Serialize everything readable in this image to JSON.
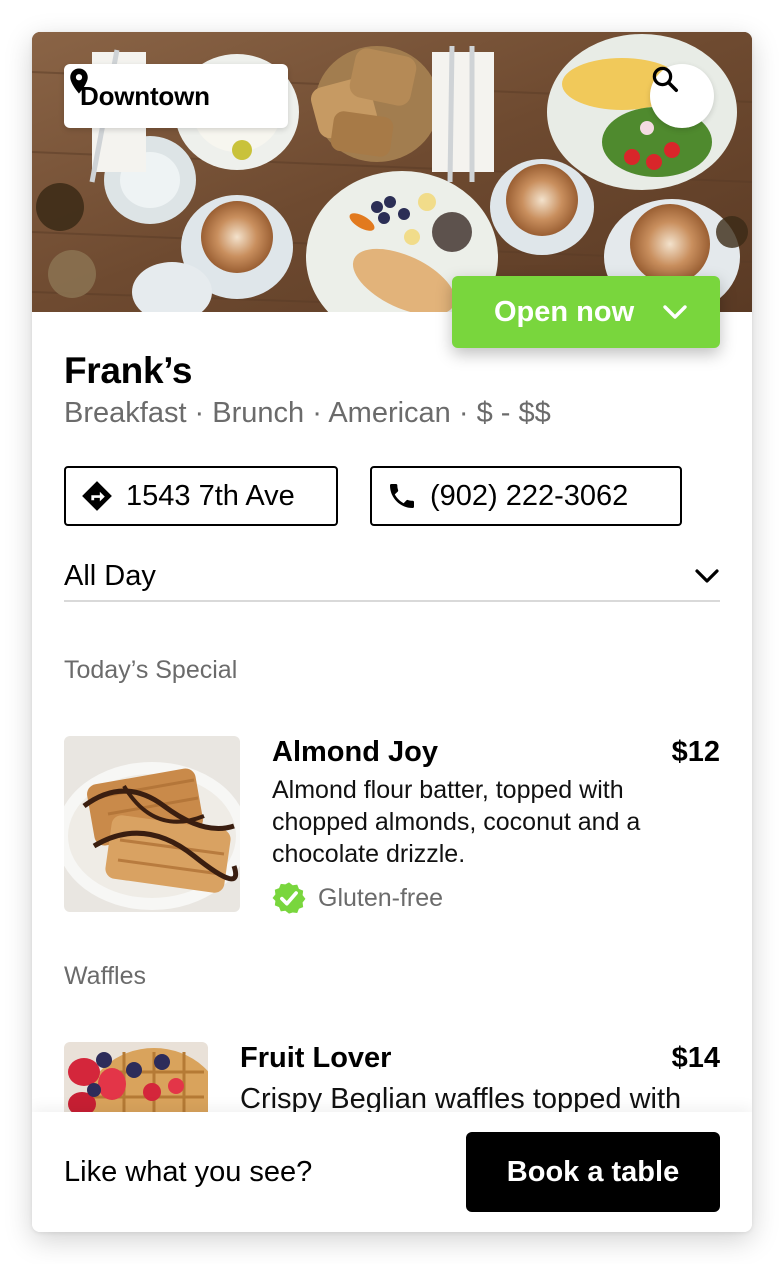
{
  "header": {
    "location_label": "Downtown",
    "location_icon": "map-pin-icon",
    "search_icon": "search-icon",
    "status_label": "Open now",
    "status_color": "#79d63d"
  },
  "restaurant": {
    "name": "Frank’s",
    "tags": "Breakfast · Brunch · American · $ - $$",
    "address": "1543 7th Ave",
    "phone": "(902) 222-3062"
  },
  "menu_select": {
    "value": "All Day"
  },
  "sections": [
    {
      "label": "Today’s Special",
      "items": [
        {
          "name": "Almond Joy",
          "price": "$12",
          "description": "Almond flour batter, topped with chopped almonds, coconut and a chocolate drizzle.",
          "badge": "Gluten-free",
          "badge_icon": "verified-check-icon"
        }
      ]
    },
    {
      "label": "Waffles",
      "items": [
        {
          "name": "Fruit Lover",
          "price": "$14",
          "description": "Crispy Beglian waffles topped with"
        }
      ]
    }
  ],
  "footer": {
    "prompt": "Like what you see?",
    "cta_label": "Book a table"
  }
}
